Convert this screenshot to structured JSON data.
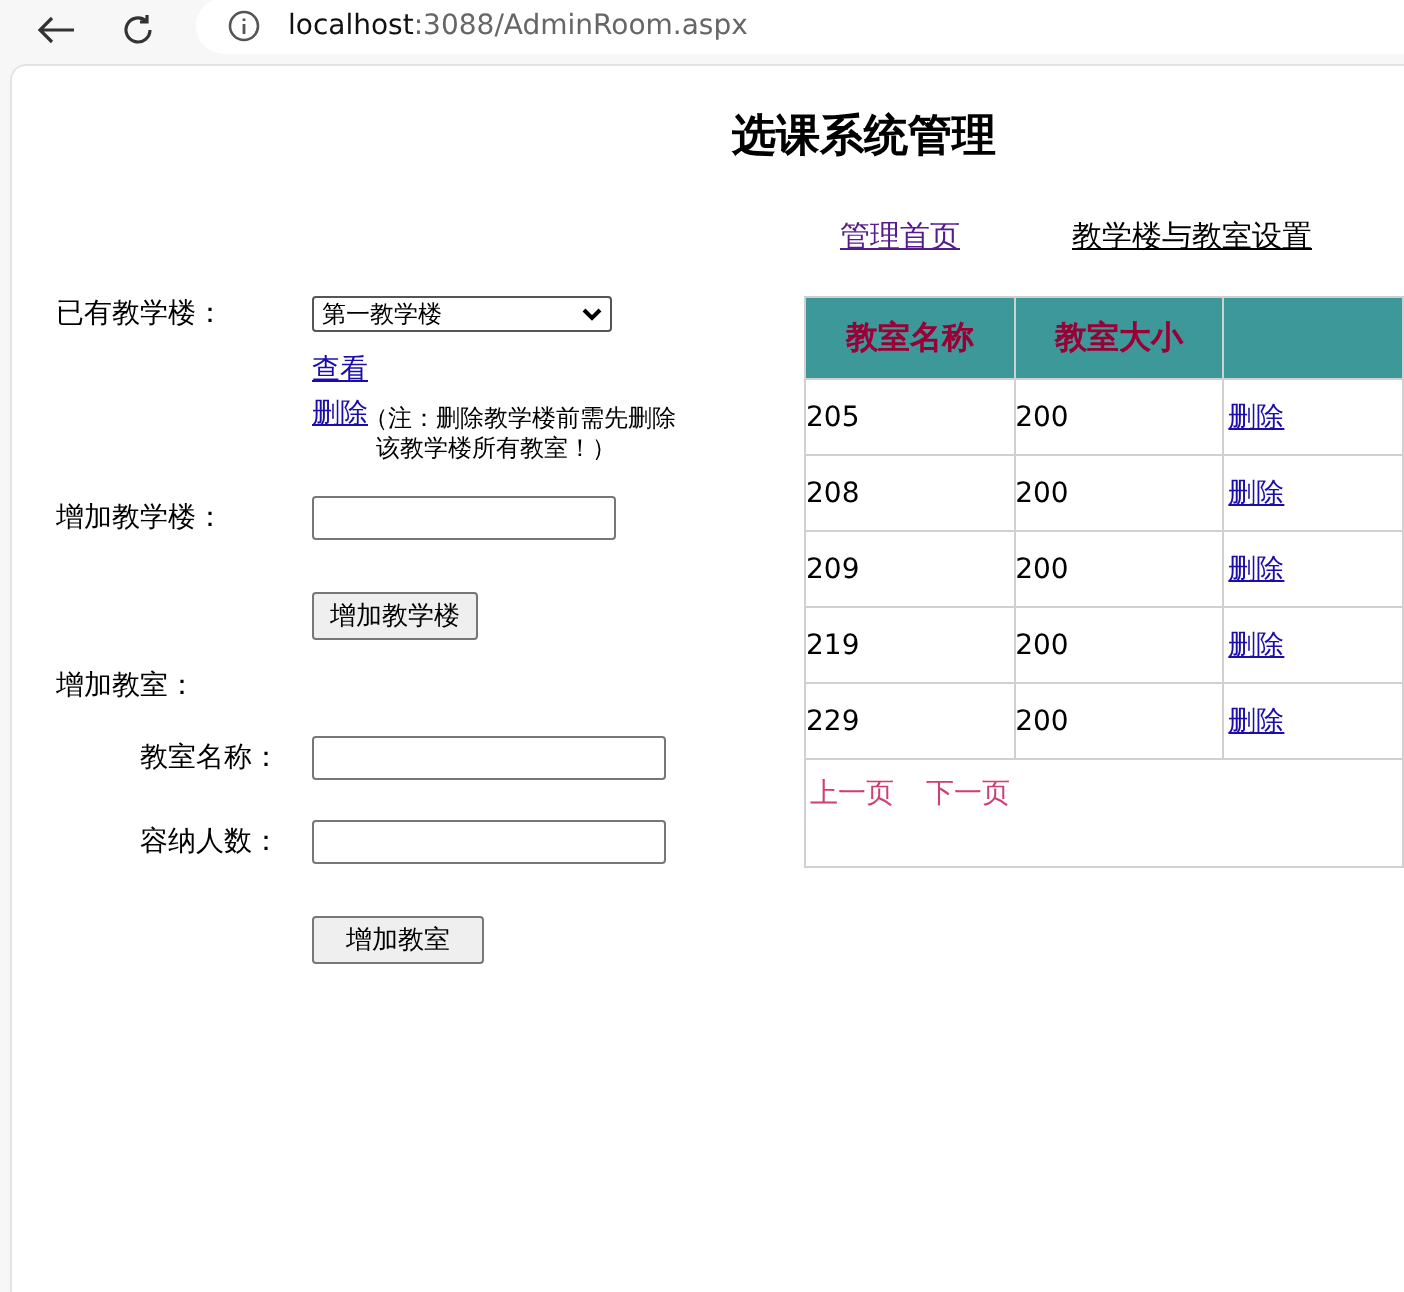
{
  "browser": {
    "host": "localhost",
    "path": ":3088/AdminRoom.aspx"
  },
  "title": "选课系统管理",
  "nav": [
    {
      "label": "管理首页",
      "visited": true
    },
    {
      "label": "教学楼与教室设置",
      "visited": false
    }
  ],
  "building": {
    "label": "已有教学楼：",
    "selected_option": "第一教学楼",
    "view_link": "查看",
    "delete_link": "删除",
    "note": "（注：删除教学楼前需先删除该教学楼所有教室！）"
  },
  "add_building": {
    "label": "增加教学楼：",
    "button": "增加教学楼"
  },
  "add_room": {
    "label": "增加教室：",
    "fields": [
      {
        "label": "教室名称："
      },
      {
        "label": "容纳人数："
      }
    ],
    "button": "增加教室"
  },
  "table": {
    "columns": [
      "教室名称",
      "教室大小"
    ],
    "rows": [
      {
        "name": "205",
        "size": "200",
        "action": "删除"
      },
      {
        "name": "208",
        "size": "200",
        "action": "删除"
      },
      {
        "name": "209",
        "size": "200",
        "action": "删除"
      },
      {
        "name": "219",
        "size": "200",
        "action": "删除"
      },
      {
        "name": "229",
        "size": "200",
        "action": "删除"
      }
    ],
    "pager": [
      "上一页",
      "下一页"
    ]
  }
}
